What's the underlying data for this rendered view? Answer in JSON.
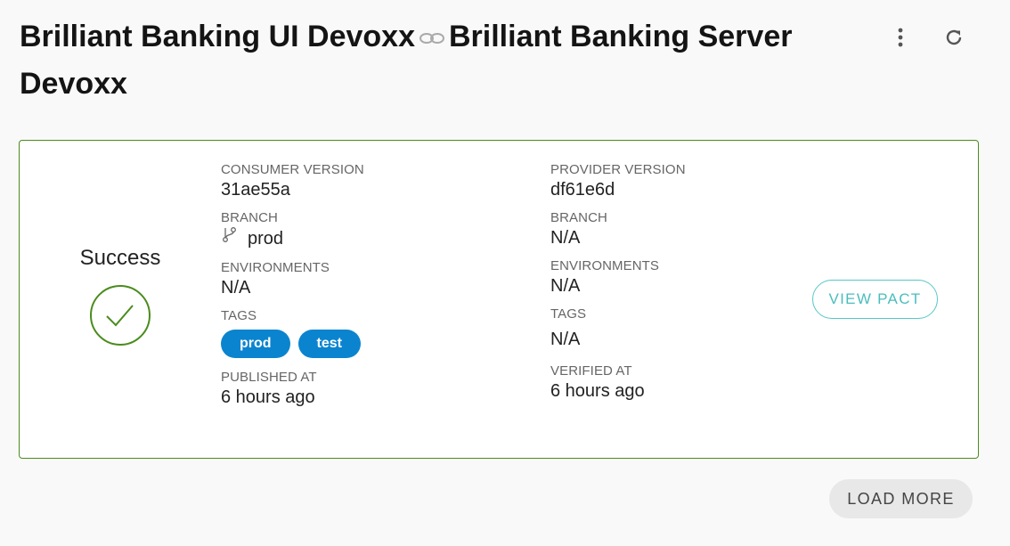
{
  "header": {
    "consumer_name": "Brilliant Banking UI Devoxx",
    "provider_name": "Brilliant Banking Server Devoxx",
    "link_icon": "infinity-link-icon",
    "menu_icon": "vertical-dots-icon",
    "refresh_icon": "refresh-icon"
  },
  "card": {
    "border_color": "#4a8c1c",
    "status": {
      "label": "Success",
      "icon": "check-circle-icon",
      "color": "#4a8c1c"
    },
    "consumer": {
      "version_label": "CONSUMER VERSION",
      "version": "31ae55a",
      "branch_label": "BRANCH",
      "branch": "prod",
      "branch_icon": "git-branch-icon",
      "environments_label": "ENVIRONMENTS",
      "environments": "N/A",
      "tags_label": "TAGS",
      "tags": [
        "prod",
        "test"
      ],
      "published_label": "PUBLISHED AT",
      "published": "6 hours ago"
    },
    "provider": {
      "version_label": "PROVIDER VERSION",
      "version": "df61e6d",
      "branch_label": "BRANCH",
      "branch": "N/A",
      "environments_label": "ENVIRONMENTS",
      "environments": "N/A",
      "tags_label": "TAGS",
      "tags": "N/A",
      "verified_label": "VERIFIED AT",
      "verified": "6 hours ago"
    },
    "view_pact_label": "VIEW PACT"
  },
  "load_more_label": "LOAD MORE",
  "colors": {
    "tag_chip": "#0b84cf",
    "view_pact": "#4bbdbd"
  }
}
